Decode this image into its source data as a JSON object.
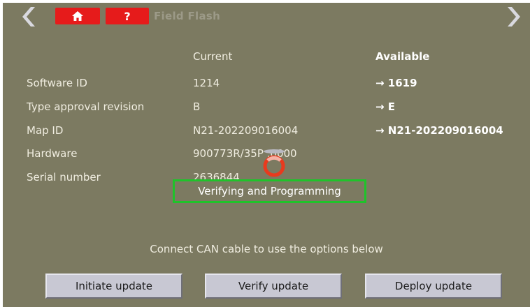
{
  "titlebar": {
    "title": "Field Flash",
    "help_label": "?",
    "back_icon": "chevron-left-icon",
    "forward_icon": "chevron-right-icon",
    "home_icon": "home-icon"
  },
  "table": {
    "headers": {
      "current": "Current",
      "available": "Available"
    },
    "rows": [
      {
        "label": "Software ID",
        "current": "1214",
        "available": "→ 1619"
      },
      {
        "label": "Type approval revision",
        "current": "B",
        "available": "→ E"
      },
      {
        "label": "Map ID",
        "current": "N21-202209016004",
        "available": "→ N21-202209016004"
      },
      {
        "label": "Hardware",
        "current": "900773R/35P ,0000",
        "available": ""
      },
      {
        "label": "Serial number",
        "current": "2636844",
        "available": ""
      }
    ]
  },
  "dialog": {
    "message": "Verifying and Programming"
  },
  "footer": {
    "message": "Connect CAN cable to use the options below",
    "buttons": {
      "initiate": "Initiate update",
      "verify": "Verify update",
      "deploy": "Deploy update"
    }
  },
  "colors": {
    "background": "#7c7a61",
    "home_button": "#e61b1b",
    "dialog_border": "#1fc32a",
    "spinner": "#e83a1e",
    "button_face": "#c8c8d3"
  }
}
